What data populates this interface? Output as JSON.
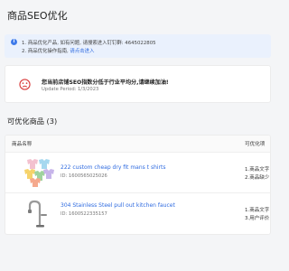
{
  "page": {
    "title": "商品SEO优化"
  },
  "notice": {
    "icon": "info-icon",
    "line1": "1. 商品优化产品, 如有问题, 请搜索进入钉钉群: 4645022805",
    "line2_prefix": "2. 商品优化操作指南,",
    "line2_link": "请点击进入"
  },
  "score": {
    "icon": "sad-face-icon",
    "title": "您当前店铺SEO指数分低于行业平均分,请继续加油!",
    "date": "Update Period: 1/3/2023"
  },
  "section": {
    "title": "可优化商品 (3)"
  },
  "table": {
    "headers": {
      "name": "商品名称",
      "optimizable": "可优化项"
    },
    "rows": [
      {
        "name": "222 custom cheap dry fit mans t shirts",
        "id": "ID: 1600565025026",
        "opt1": "1.商品文字",
        "opt2": "2.商品缺少",
        "thumb": "tshirts-thumbnail"
      },
      {
        "name": "304 Stainless Steel pull out kitchen faucet",
        "id": "ID: 1600522335157",
        "opt1": "1.商品文字",
        "opt2": "3.用户评价",
        "thumb": "faucet-thumbnail"
      }
    ]
  },
  "colors": {
    "accent": "#2f6be0",
    "notice_bg": "#eaf1fd",
    "sad_icon": "#d93b3b"
  }
}
